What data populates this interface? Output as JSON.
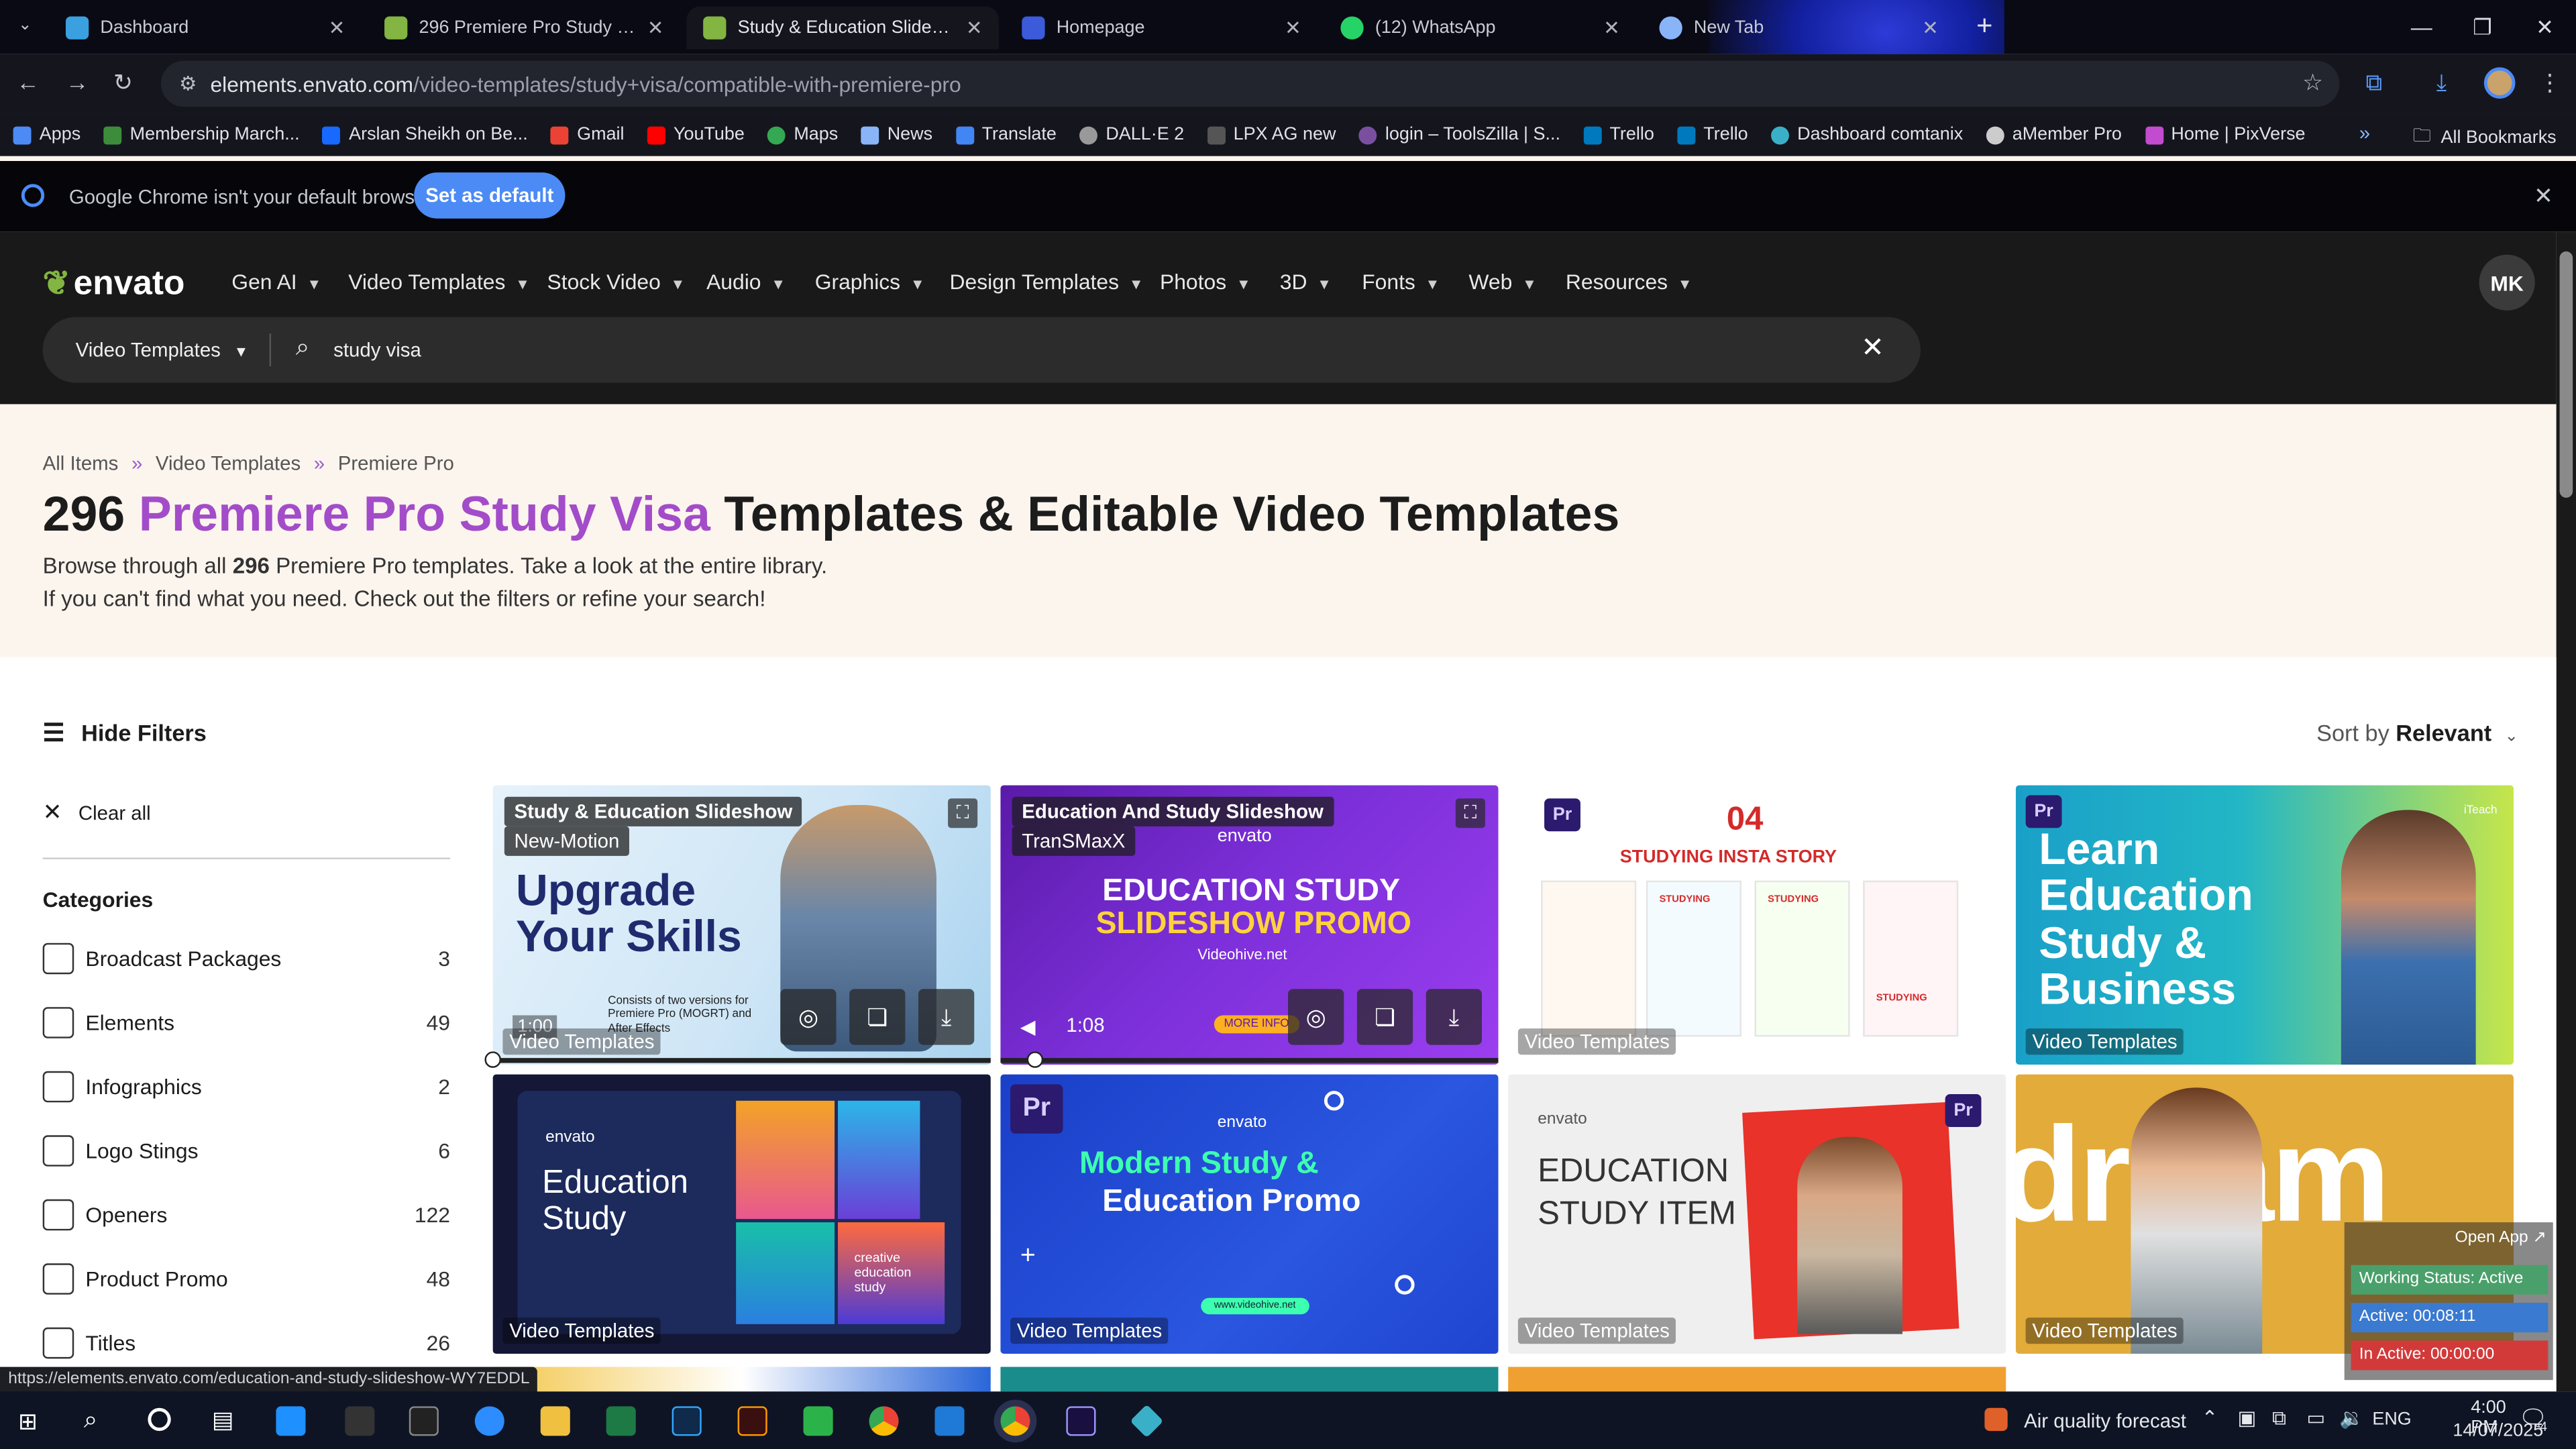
{
  "browser": {
    "tabs": [
      {
        "title": "Dashboard",
        "color": "#3aa0e0"
      },
      {
        "title": "296 Premiere Pro Study Visa Te",
        "color": "#82b541"
      },
      {
        "title": "Study & Education Slideshow, V",
        "color": "#82b541"
      },
      {
        "title": "Homepage",
        "color": "#3b5bdb"
      },
      {
        "title": "(12) WhatsApp",
        "color": "#25d366"
      },
      {
        "title": "New Tab",
        "color": "#8ab4f8"
      }
    ],
    "url_host": "elements.envato.com",
    "url_path": "/video-templates/study+visa/compatible-with-premiere-pro",
    "bookmarks": [
      "Apps",
      "Membership March...",
      "Arslan Sheikh on Be...",
      "Gmail",
      "YouTube",
      "Maps",
      "News",
      "Translate",
      "DALL·E 2",
      "LPX AG new",
      "login – ToolsZilla | S...",
      "Trello",
      "Trello",
      "Dashboard comtanix",
      "aMember Pro",
      "Home | PixVerse"
    ],
    "all_bookmarks": "All Bookmarks",
    "infobar_text": "Google Chrome isn't your default browser",
    "set_default": "Set as default"
  },
  "site": {
    "logo": "envato",
    "menu": [
      "Gen AI",
      "Video Templates",
      "Stock Video",
      "Audio",
      "Graphics",
      "Design Templates",
      "Photos",
      "3D",
      "Fonts",
      "Web",
      "Resources"
    ],
    "avatar": "MK",
    "search_category": "Video Templates",
    "search_query": "study visa"
  },
  "hero": {
    "breadcrumbs": [
      "All Items",
      "Video Templates",
      "Premiere Pro"
    ],
    "title_count": "296",
    "title_highlight": "Premiere Pro Study Visa",
    "title_rest": "Templates & Editable Video Templates",
    "sub1_a": "Browse through all",
    "sub1_b": "296",
    "sub1_c": "Premiere Pro templates. Take a look at the entire library.",
    "sub2": "If you can't find what you need. Check out the filters or refine your search!"
  },
  "filters": {
    "hide_label": "Hide Filters",
    "clear_label": "Clear all",
    "categories_heading": "Categories",
    "categories": [
      {
        "label": "Broadcast Packages",
        "count": "3"
      },
      {
        "label": "Elements",
        "count": "49"
      },
      {
        "label": "Infographics",
        "count": "2"
      },
      {
        "label": "Logo Stings",
        "count": "6"
      },
      {
        "label": "Openers",
        "count": "122"
      },
      {
        "label": "Product Promo",
        "count": "48"
      },
      {
        "label": "Titles",
        "count": "26"
      }
    ]
  },
  "sort": {
    "label": "Sort by",
    "value": "Relevant"
  },
  "cards": {
    "badge": "Video Templates",
    "c1": {
      "title": "Study & Education Slideshow",
      "author": "New-Motion",
      "line1": "Upgrade",
      "line2": "Your Skills",
      "desc": "Consists of two versions for Premiere Pro (MOGRT) and After Effects",
      "time": "1:00"
    },
    "c2": {
      "title": "Education And Study Slideshow",
      "author": "TranSMaxX",
      "brand": "envato",
      "line1": "EDUCATION STUDY",
      "line2": "SLIDESHOW PROMO",
      "site": "Videohive.net",
      "more": "MORE INFO",
      "time": "1:08"
    },
    "c3": {
      "num": "04",
      "heading": "STUDYING INSTA STORY",
      "item": "STUDYING",
      "pr": "Pr"
    },
    "c4": {
      "text": "Learn Education Study & Business",
      "pr": "Pr",
      "corner": "iTeach"
    },
    "c5": {
      "brand": "envato",
      "line1": "Education",
      "line2": "Study",
      "tag": "creative education study"
    },
    "c6": {
      "pr": "Pr",
      "brand": "envato",
      "line1": "Modern Study &",
      "line2": "Education Promo",
      "site": "www.videohive.net"
    },
    "c7": {
      "brand": "envato",
      "line1": "EDUCATION",
      "line2": "STUDY ITEM",
      "pr": "Pr"
    },
    "c8": {
      "text": "dream"
    }
  },
  "status_overlay": {
    "open_app": "Open App ↗",
    "working": "Working Status: Active",
    "active": "Active: 00:08:11",
    "inactive": "In Active: 00:00:00"
  },
  "status_url": "https://elements.envato.com/education-and-study-slideshow-WY7EDDL",
  "taskbar": {
    "weather": "Air quality forecast",
    "lang": "ENG",
    "time": "4:00 PM",
    "date": "14/07/2025",
    "notif": "4"
  }
}
